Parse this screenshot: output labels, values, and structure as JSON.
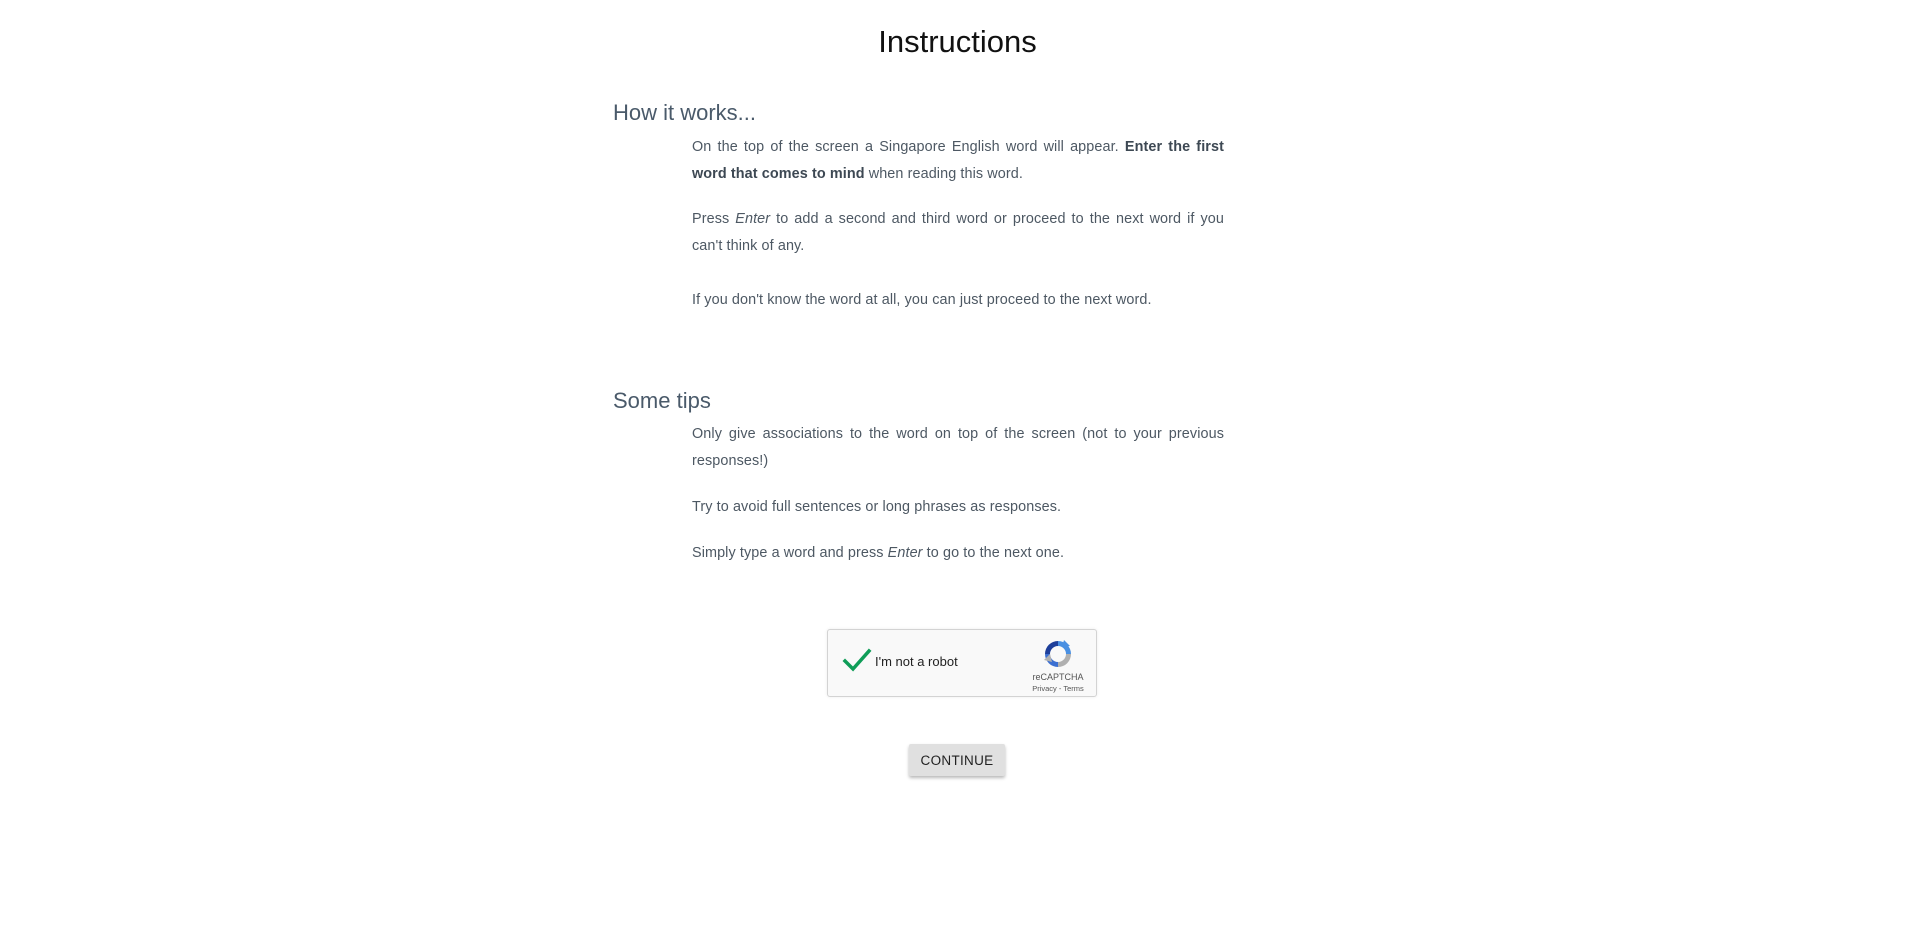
{
  "title": "Instructions",
  "how_it_works": {
    "heading": "How it works...",
    "p1": {
      "part1": "On the top of the screen a Singapore English word will appear. ",
      "bold": "Enter the first word that comes to mind",
      "part2": " when reading this word."
    },
    "p2": {
      "part1": "Press ",
      "italic": "Enter",
      "part2": " to add a second and third word or proceed to the next word if you can't think of any."
    },
    "p3": "If you don't know the word at all, you can just proceed to the next word."
  },
  "tips": {
    "heading": "Some tips",
    "t1": "Only give associations to the word on top of the screen (not to your previous responses!)",
    "t2": "Try to avoid full sentences or long phrases as responses.",
    "t3": {
      "part1": "Simply type a word and press ",
      "italic": "Enter",
      "part2": " to go to the next one."
    }
  },
  "recaptcha": {
    "label": "I'm not a robot",
    "brand": "reCAPTCHA",
    "privacy": "Privacy",
    "separator": " - ",
    "terms": "Terms",
    "checked": true,
    "check_color": "#0f9d58"
  },
  "continue_label": "CONTINUE"
}
